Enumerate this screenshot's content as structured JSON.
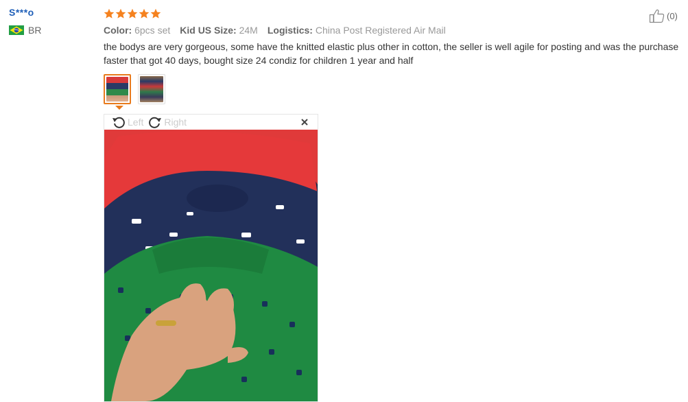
{
  "reviewer": {
    "name": "S***o",
    "country_code": "BR",
    "flag_icon": "brazil-flag-icon"
  },
  "review": {
    "rating": 5,
    "star_color": "#f5821f",
    "meta": [
      {
        "key": "Color:",
        "value": "6pcs set"
      },
      {
        "key": "Kid US Size:",
        "value": "24M"
      },
      {
        "key": "Logistics:",
        "value": "China Post Registered Air Mail"
      }
    ],
    "text": "the bodys are very gorgeous, some have the knitted elastic plus other in cotton, the seller is well agile for posting and was the purchase faster that got 40 days, bought size 24 condiz for children 1 year and half",
    "helpful_count": "(0)"
  },
  "photos": {
    "thumbnails": [
      "photo-thumbnail-1",
      "photo-thumbnail-2"
    ],
    "active_index": 0,
    "viewer": {
      "rotate_left_label": "Left",
      "rotate_right_label": "Right",
      "close_icon": "close-icon"
    }
  },
  "colors": {
    "accent": "#e87a1c",
    "link": "#1f5fb8"
  }
}
